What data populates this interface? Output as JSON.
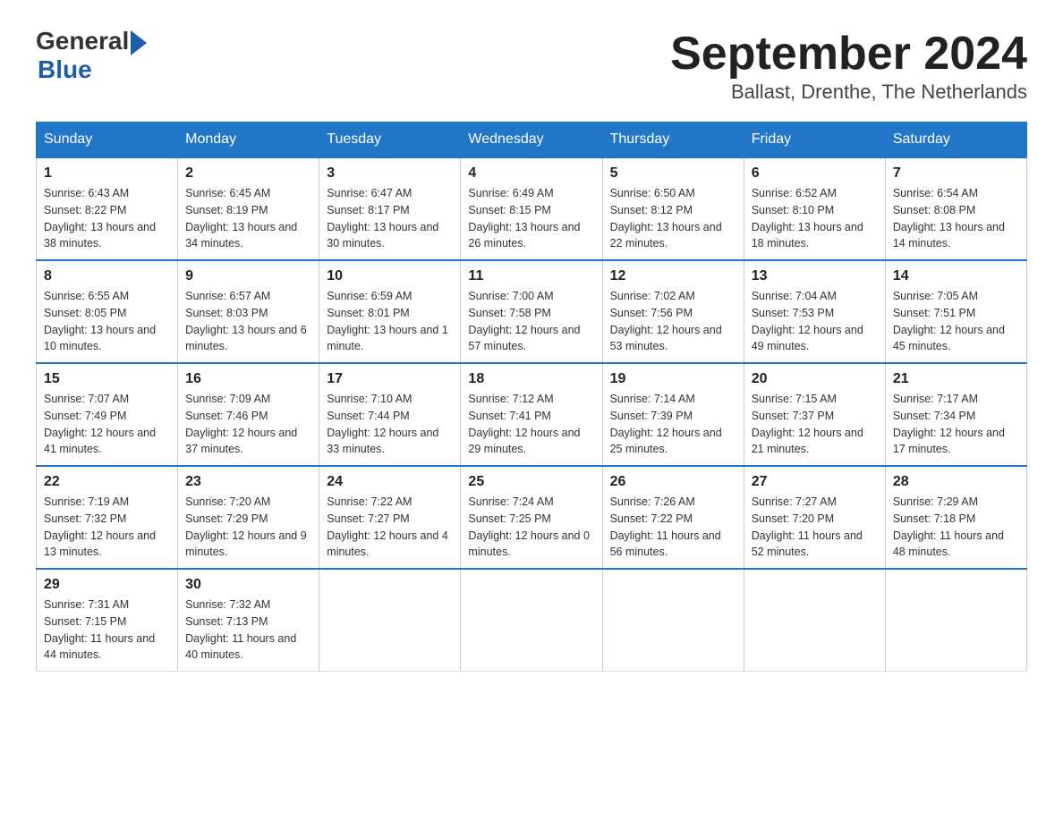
{
  "logo": {
    "text_general": "General",
    "text_blue": "Blue"
  },
  "title": "September 2024",
  "subtitle": "Ballast, Drenthe, The Netherlands",
  "days_of_week": [
    "Sunday",
    "Monday",
    "Tuesday",
    "Wednesday",
    "Thursday",
    "Friday",
    "Saturday"
  ],
  "weeks": [
    [
      {
        "day": "1",
        "sunrise": "6:43 AM",
        "sunset": "8:22 PM",
        "daylight": "13 hours and 38 minutes."
      },
      {
        "day": "2",
        "sunrise": "6:45 AM",
        "sunset": "8:19 PM",
        "daylight": "13 hours and 34 minutes."
      },
      {
        "day": "3",
        "sunrise": "6:47 AM",
        "sunset": "8:17 PM",
        "daylight": "13 hours and 30 minutes."
      },
      {
        "day": "4",
        "sunrise": "6:49 AM",
        "sunset": "8:15 PM",
        "daylight": "13 hours and 26 minutes."
      },
      {
        "day": "5",
        "sunrise": "6:50 AM",
        "sunset": "8:12 PM",
        "daylight": "13 hours and 22 minutes."
      },
      {
        "day": "6",
        "sunrise": "6:52 AM",
        "sunset": "8:10 PM",
        "daylight": "13 hours and 18 minutes."
      },
      {
        "day": "7",
        "sunrise": "6:54 AM",
        "sunset": "8:08 PM",
        "daylight": "13 hours and 14 minutes."
      }
    ],
    [
      {
        "day": "8",
        "sunrise": "6:55 AM",
        "sunset": "8:05 PM",
        "daylight": "13 hours and 10 minutes."
      },
      {
        "day": "9",
        "sunrise": "6:57 AM",
        "sunset": "8:03 PM",
        "daylight": "13 hours and 6 minutes."
      },
      {
        "day": "10",
        "sunrise": "6:59 AM",
        "sunset": "8:01 PM",
        "daylight": "13 hours and 1 minute."
      },
      {
        "day": "11",
        "sunrise": "7:00 AM",
        "sunset": "7:58 PM",
        "daylight": "12 hours and 57 minutes."
      },
      {
        "day": "12",
        "sunrise": "7:02 AM",
        "sunset": "7:56 PM",
        "daylight": "12 hours and 53 minutes."
      },
      {
        "day": "13",
        "sunrise": "7:04 AM",
        "sunset": "7:53 PM",
        "daylight": "12 hours and 49 minutes."
      },
      {
        "day": "14",
        "sunrise": "7:05 AM",
        "sunset": "7:51 PM",
        "daylight": "12 hours and 45 minutes."
      }
    ],
    [
      {
        "day": "15",
        "sunrise": "7:07 AM",
        "sunset": "7:49 PM",
        "daylight": "12 hours and 41 minutes."
      },
      {
        "day": "16",
        "sunrise": "7:09 AM",
        "sunset": "7:46 PM",
        "daylight": "12 hours and 37 minutes."
      },
      {
        "day": "17",
        "sunrise": "7:10 AM",
        "sunset": "7:44 PM",
        "daylight": "12 hours and 33 minutes."
      },
      {
        "day": "18",
        "sunrise": "7:12 AM",
        "sunset": "7:41 PM",
        "daylight": "12 hours and 29 minutes."
      },
      {
        "day": "19",
        "sunrise": "7:14 AM",
        "sunset": "7:39 PM",
        "daylight": "12 hours and 25 minutes."
      },
      {
        "day": "20",
        "sunrise": "7:15 AM",
        "sunset": "7:37 PM",
        "daylight": "12 hours and 21 minutes."
      },
      {
        "day": "21",
        "sunrise": "7:17 AM",
        "sunset": "7:34 PM",
        "daylight": "12 hours and 17 minutes."
      }
    ],
    [
      {
        "day": "22",
        "sunrise": "7:19 AM",
        "sunset": "7:32 PM",
        "daylight": "12 hours and 13 minutes."
      },
      {
        "day": "23",
        "sunrise": "7:20 AM",
        "sunset": "7:29 PM",
        "daylight": "12 hours and 9 minutes."
      },
      {
        "day": "24",
        "sunrise": "7:22 AM",
        "sunset": "7:27 PM",
        "daylight": "12 hours and 4 minutes."
      },
      {
        "day": "25",
        "sunrise": "7:24 AM",
        "sunset": "7:25 PM",
        "daylight": "12 hours and 0 minutes."
      },
      {
        "day": "26",
        "sunrise": "7:26 AM",
        "sunset": "7:22 PM",
        "daylight": "11 hours and 56 minutes."
      },
      {
        "day": "27",
        "sunrise": "7:27 AM",
        "sunset": "7:20 PM",
        "daylight": "11 hours and 52 minutes."
      },
      {
        "day": "28",
        "sunrise": "7:29 AM",
        "sunset": "7:18 PM",
        "daylight": "11 hours and 48 minutes."
      }
    ],
    [
      {
        "day": "29",
        "sunrise": "7:31 AM",
        "sunset": "7:15 PM",
        "daylight": "11 hours and 44 minutes."
      },
      {
        "day": "30",
        "sunrise": "7:32 AM",
        "sunset": "7:13 PM",
        "daylight": "11 hours and 40 minutes."
      },
      null,
      null,
      null,
      null,
      null
    ]
  ]
}
